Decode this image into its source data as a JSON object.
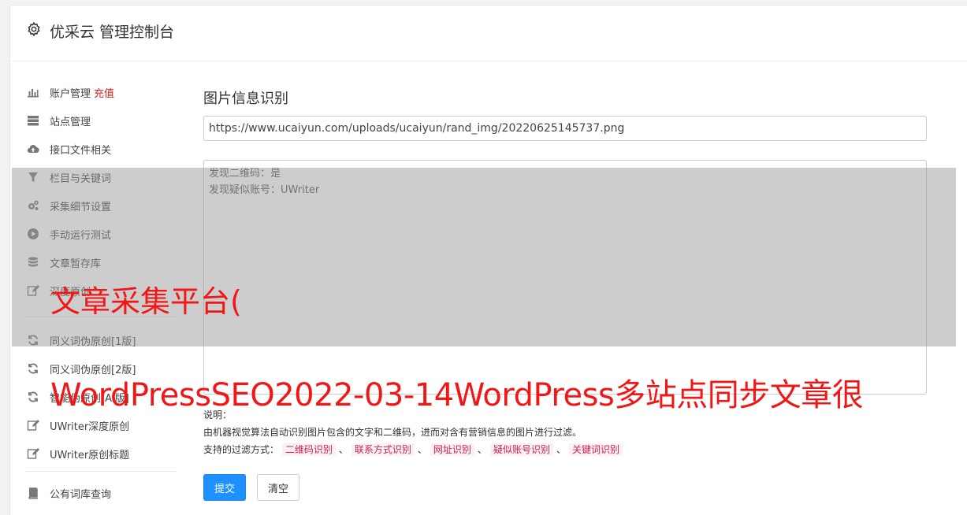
{
  "header": {
    "title": "优采云 管理控制台",
    "icon": "gear-icon"
  },
  "sidebar": {
    "items": [
      {
        "label": "账户管理",
        "badge": "充值",
        "icon": "bar-chart-icon"
      },
      {
        "label": "站点管理",
        "icon": "server-icon"
      },
      {
        "label": "接口文件相关",
        "icon": "cloud-upload-icon"
      },
      {
        "label": "栏目与关键词",
        "icon": "filter-icon"
      },
      {
        "label": "采集细节设置",
        "icon": "cogs-icon"
      },
      {
        "label": "手动运行测试",
        "icon": "play-circle-icon"
      },
      {
        "label": "文章暂存库",
        "icon": "database-icon"
      },
      {
        "label": "深度原创",
        "icon": "edit-icon"
      },
      {
        "label": "同义词伪原创[1版]",
        "icon": "refresh-icon"
      },
      {
        "label": "同义词伪原创[2版]",
        "icon": "refresh-icon"
      },
      {
        "label": "智能伪原创[AI版]",
        "icon": "refresh-icon"
      },
      {
        "label": "UWriter深度原创",
        "icon": "edit-icon"
      },
      {
        "label": "UWriter原创标题",
        "icon": "edit-icon"
      },
      {
        "label": "公有词库查询",
        "icon": "book-icon"
      }
    ]
  },
  "main": {
    "section_title": "图片信息识别",
    "url_value": "https://www.ucaiyun.com/uploads/ucaiyun/rand_img/20220625145737.png",
    "result_lines": [
      "发现二维码：是",
      "发现疑似账号：UWriter"
    ],
    "notes": {
      "label": "说明：",
      "description": "由机器视觉算法自动识别图片包含的文字和二维码，进而对含有营销信息的图片进行过滤。",
      "filter_label": "支持的过滤方式：",
      "separator": "、",
      "filters": [
        "二维码识别",
        "联系方式识别",
        "网址识别",
        "疑似账号识别",
        "关键词识别"
      ]
    },
    "submit_label": "提交",
    "clear_label": "清空"
  },
  "watermark": {
    "line1": "文章采集平台(",
    "line2": "WordPressSEO2022-03-14WordPress多站点同步文章很"
  },
  "colors": {
    "accent": "#1e90ff",
    "danger": "#e02020",
    "watermark": "#f21717",
    "tag_text": "#c7254e"
  }
}
